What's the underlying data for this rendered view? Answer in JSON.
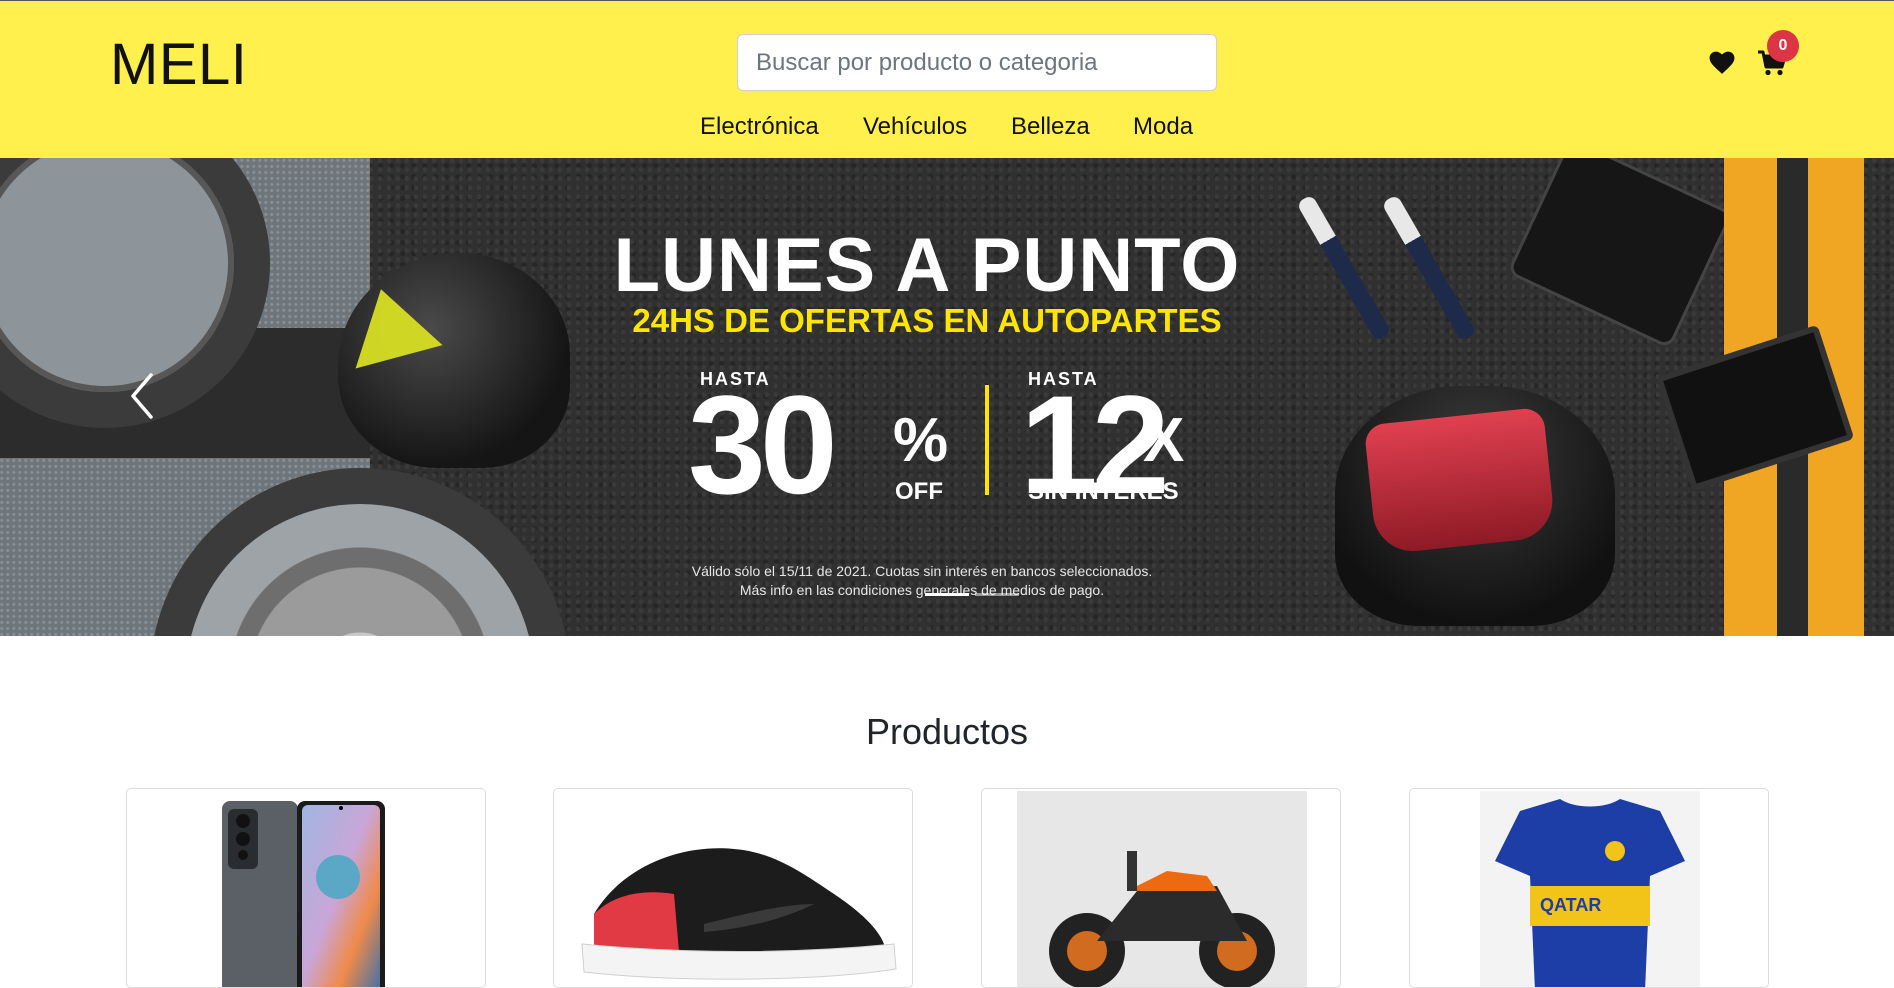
{
  "header": {
    "logo": "MELI",
    "search_placeholder": "Buscar por producto o categoria",
    "nav": [
      "Electrónica",
      "Vehículos",
      "Belleza",
      "Moda"
    ],
    "cart_count": "0",
    "icons": [
      "heart-icon",
      "cart-icon"
    ]
  },
  "banner": {
    "title": "LUNES A PUNTO",
    "subtitle": "24HS DE OFERTAS EN AUTOPARTES",
    "left_prefix": "HASTA",
    "left_value": "30",
    "left_unit": "%",
    "left_suffix": "OFF",
    "right_prefix": "HASTA",
    "right_value": "12",
    "right_unit": "X",
    "right_suffix": "SIN INTERÉS",
    "legal_line1": "Válido sólo el 15/11 de 2021. Cuotas sin interés en bancos seleccionados.",
    "legal_line2": "Más info en las condiciones generales de medios de pago.",
    "slides": 2,
    "active_slide": 1
  },
  "products": {
    "title": "Productos",
    "items": [
      {
        "name": "smartphone"
      },
      {
        "name": "sneaker"
      },
      {
        "name": "motorcycle"
      },
      {
        "name": "football-jersey"
      }
    ]
  },
  "colors": {
    "header_bg": "#fff04d",
    "badge": "#dc3545",
    "banner_accent": "#ffe600"
  }
}
